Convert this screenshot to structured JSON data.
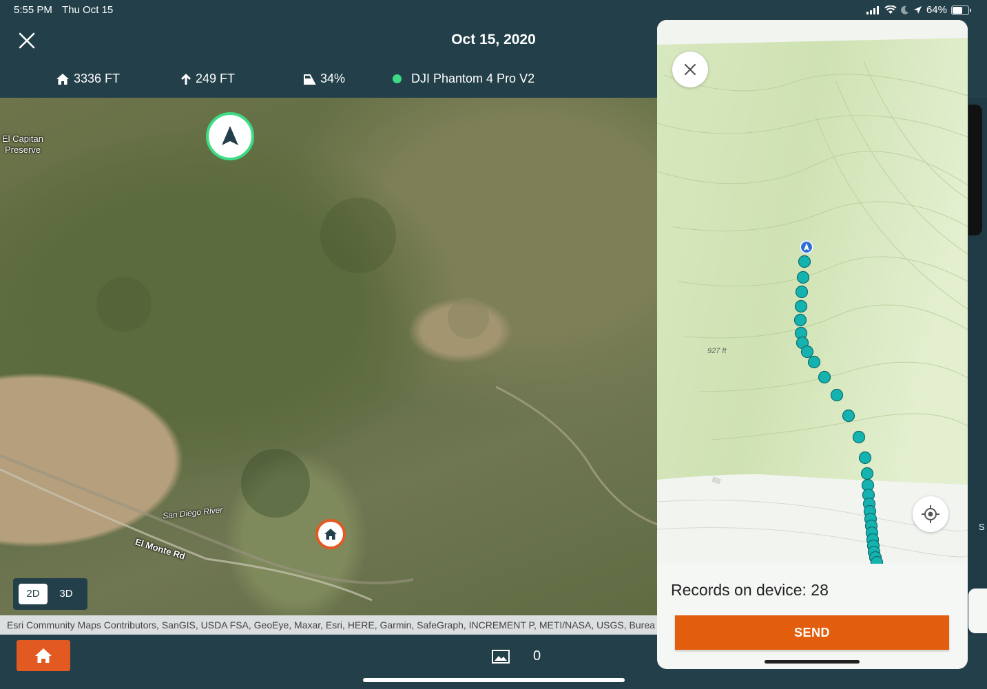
{
  "status_bar": {
    "time": "5:55 PM",
    "date": "Thu Oct 15",
    "battery": "64%",
    "icons": [
      "signal-icon",
      "wifi-icon",
      "moon-icon",
      "location-arrow-icon",
      "battery-icon"
    ]
  },
  "header": {
    "title": "Oct 15, 2020",
    "close_icon": "close-icon",
    "stats": {
      "home_distance": "3336 FT",
      "altitude": "249 FT",
      "battery": "34%",
      "drone_name": "DJI Phantom 4 Pro V2",
      "connection_status_color": "#3ddc84"
    }
  },
  "map": {
    "labels": {
      "preserve_line1": "El Capitan",
      "preserve_line2": "Preserve",
      "river": "San Diego River",
      "road": "El Monte Rd"
    },
    "view_toggle": {
      "options": [
        "2D",
        "3D"
      ],
      "selected": "2D"
    },
    "attribution": "Esri Community Maps Contributors, SanGIS, USDA FSA, GeoEye, Maxar, Esri, HERE, Garmin, SafeGraph, INCREMENT P, METI/NASA, USGS, Burea"
  },
  "bottom_bar": {
    "photo_count": "0",
    "home_button_icon": "home-icon",
    "photo_icon": "image-icon"
  },
  "records_panel": {
    "elevation_label": "927 ft",
    "records_text": "Records on device: 28",
    "send_label": "SEND",
    "track_color": "#14b3b0",
    "accent_color": "#e25e0d"
  },
  "edge_text": "S"
}
